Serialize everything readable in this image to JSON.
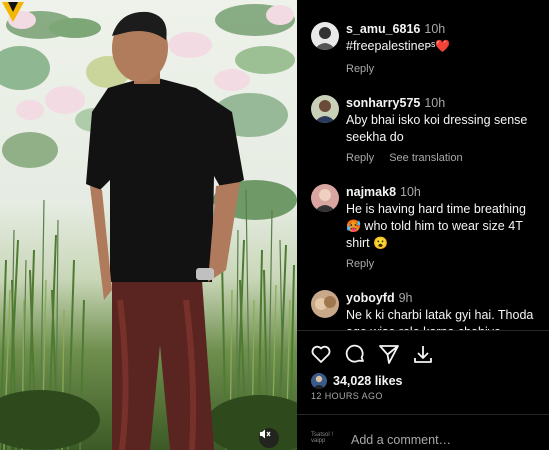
{
  "media": {
    "watermark_label": "VV",
    "mute_icon": "speaker-muted-icon"
  },
  "comments": [
    {
      "user": "s_amu_6816",
      "time": "10h",
      "text": "#freepalestineᴘˢ",
      "heart": "❤️",
      "reply": "Reply"
    },
    {
      "user": "sonharry575",
      "time": "10h",
      "text": "Aby bhai isko koi dressing sense seekha do",
      "reply": "Reply",
      "see_translation": "See translation"
    },
    {
      "user": "najmak8",
      "time": "10h",
      "text_a": "He is having hard time breathing",
      "emoji_a": "🥵",
      "text_b": " who told him to wear size 4T shirt",
      "emoji_b": "😮",
      "reply": "Reply"
    },
    {
      "user": "yoboyfd",
      "time": "9h",
      "text": "Ne k ki charbi latak gyi hai. Thoda age wise role karna chahiye lambe"
    }
  ],
  "actions": {
    "like": "heart-icon",
    "comment": "comment-icon",
    "share": "send-icon",
    "save": "save-icon"
  },
  "likes": {
    "count": "34,028 likes"
  },
  "timestamp": "12 HOURS AGO",
  "add_comment": {
    "placeholder": "Add a comment…",
    "emoji_label": "Tsatsol ! vaipp"
  }
}
